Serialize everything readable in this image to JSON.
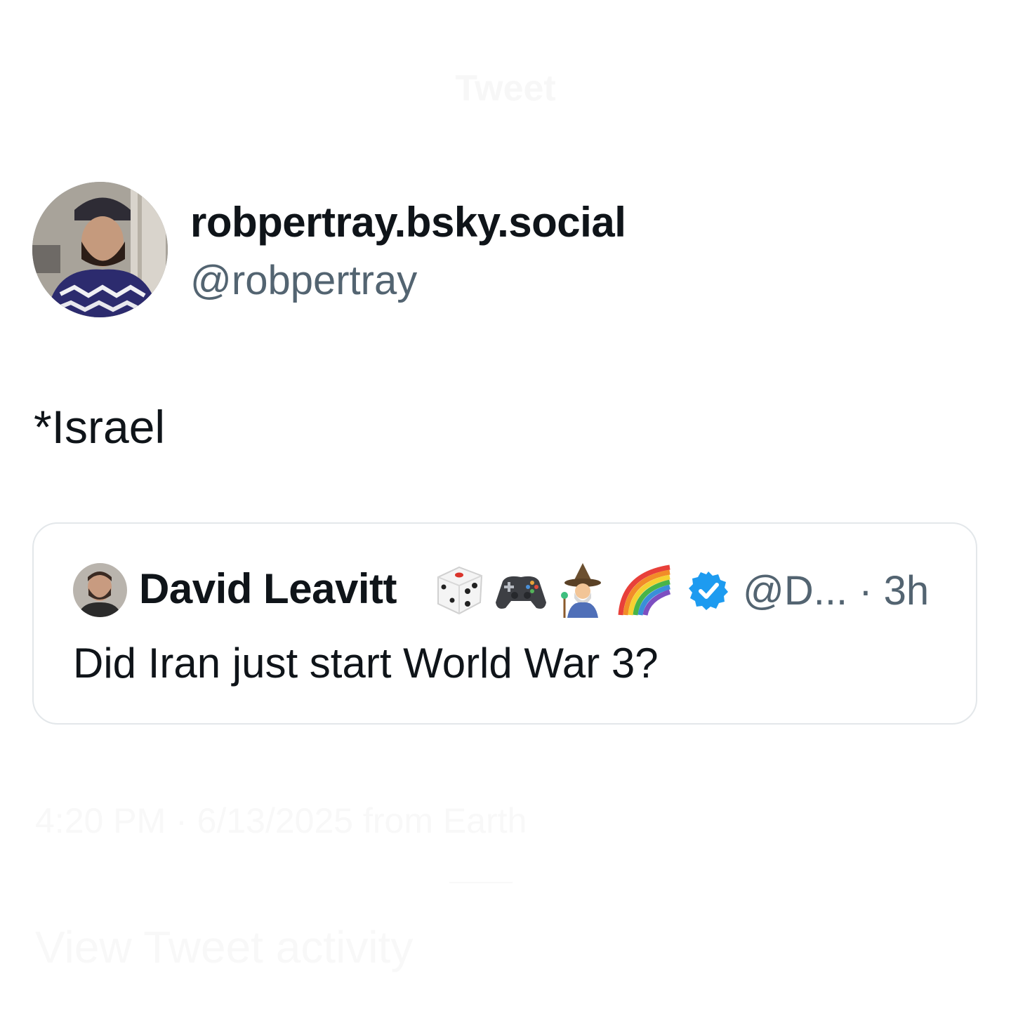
{
  "header": {
    "title": "Tweet"
  },
  "post": {
    "author_name": "robpertray.bsky.social",
    "author_handle": "@robpertray",
    "text": "*Israel"
  },
  "quoted": {
    "author_name": "David Leavitt",
    "emojis": [
      "game-die-icon",
      "video-game-icon",
      "mage-icon",
      "rainbow-icon"
    ],
    "verified": true,
    "handle_time": "@D... · 3h",
    "text": "Did Iran just start World War 3?"
  },
  "footer": {
    "meta": "4:20 PM · 6/13/2025 from Earth",
    "activity": "View Tweet activity"
  },
  "colors": {
    "text": "#0f1419",
    "secondary": "#536471",
    "border": "#e3e7ea",
    "verified": "#1d9bf0"
  }
}
